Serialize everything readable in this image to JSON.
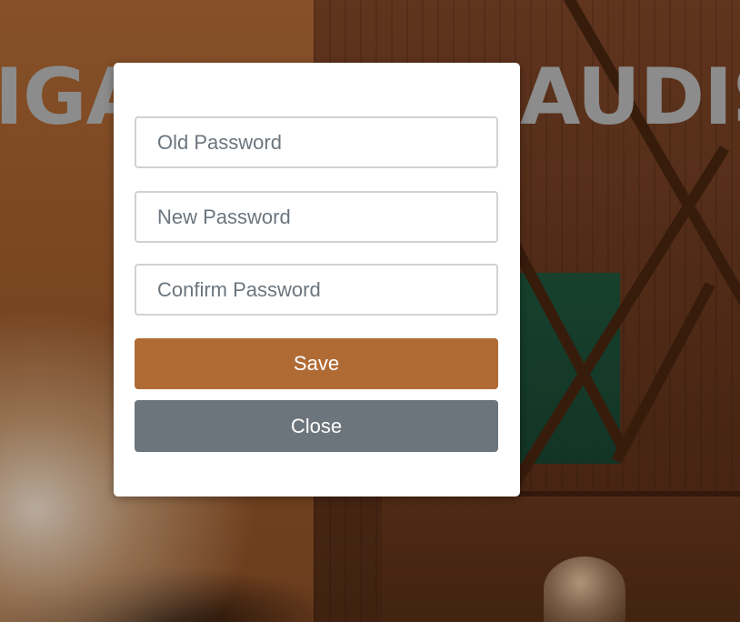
{
  "background": {
    "title_left": "IGA",
    "title_right": "AUDIS"
  },
  "modal": {
    "fields": {
      "old_password": {
        "placeholder": "Old Password",
        "value": ""
      },
      "new_password": {
        "placeholder": "New Password",
        "value": ""
      },
      "confirm_password": {
        "placeholder": "Confirm Password",
        "value": ""
      }
    },
    "buttons": {
      "save_label": "Save",
      "close_label": "Close"
    }
  },
  "colors": {
    "save_button": "#b06b35",
    "close_button": "#6d757c",
    "field_border": "#cfd2d6",
    "modal_background": "#ffffff"
  }
}
